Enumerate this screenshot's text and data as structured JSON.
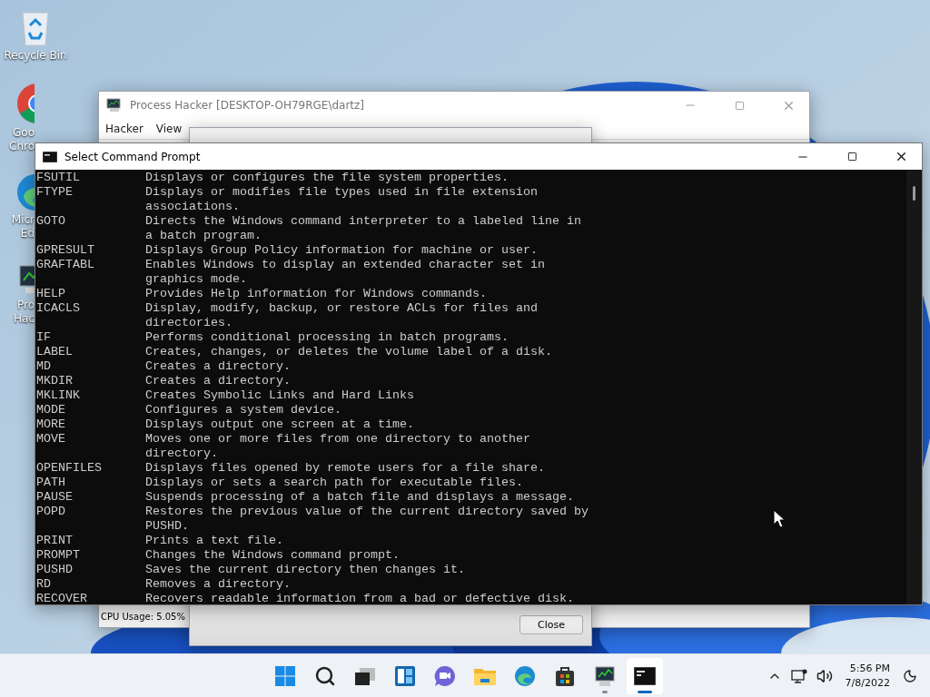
{
  "desktop_icons": [
    {
      "kind": "recycle-bin",
      "label_lines": [
        "Recycle Bin"
      ],
      "clipped": false
    },
    {
      "kind": "browser",
      "label_lines": [
        "Goo",
        "Chro"
      ],
      "clipped": true
    },
    {
      "kind": "edge",
      "label_lines": [
        "Micr",
        "Ed"
      ],
      "clipped": true
    },
    {
      "kind": "monitor-app",
      "label_lines": [
        "Pro",
        "Hac"
      ],
      "clipped": true
    }
  ],
  "process_hacker": {
    "title": "Process Hacker [DESKTOP-OH79RGE\\dartz]",
    "menu": [
      "Hacker",
      "View"
    ],
    "status": "CPU Usage: 5.05%"
  },
  "properties_dialog": {
    "button": "Close"
  },
  "command_prompt": {
    "title": "Select Command Prompt",
    "entries": [
      {
        "command": "FSUTIL",
        "description": [
          "Displays or configures the file system properties."
        ]
      },
      {
        "command": "FTYPE",
        "description": [
          "Displays or modifies file types used in file extension",
          "associations."
        ]
      },
      {
        "command": "GOTO",
        "description": [
          "Directs the Windows command interpreter to a labeled line in",
          "a batch program."
        ]
      },
      {
        "command": "GPRESULT",
        "description": [
          "Displays Group Policy information for machine or user."
        ]
      },
      {
        "command": "GRAFTABL",
        "description": [
          "Enables Windows to display an extended character set in",
          "graphics mode."
        ]
      },
      {
        "command": "HELP",
        "description": [
          "Provides Help information for Windows commands."
        ]
      },
      {
        "command": "ICACLS",
        "description": [
          "Display, modify, backup, or restore ACLs for files and",
          "directories."
        ]
      },
      {
        "command": "IF",
        "description": [
          "Performs conditional processing in batch programs."
        ]
      },
      {
        "command": "LABEL",
        "description": [
          "Creates, changes, or deletes the volume label of a disk."
        ]
      },
      {
        "command": "MD",
        "description": [
          "Creates a directory."
        ]
      },
      {
        "command": "MKDIR",
        "description": [
          "Creates a directory."
        ]
      },
      {
        "command": "MKLINK",
        "description": [
          "Creates Symbolic Links and Hard Links"
        ]
      },
      {
        "command": "MODE",
        "description": [
          "Configures a system device."
        ]
      },
      {
        "command": "MORE",
        "description": [
          "Displays output one screen at a time."
        ]
      },
      {
        "command": "MOVE",
        "description": [
          "Moves one or more files from one directory to another",
          "directory."
        ]
      },
      {
        "command": "OPENFILES",
        "description": [
          "Displays files opened by remote users for a file share."
        ]
      },
      {
        "command": "PATH",
        "description": [
          "Displays or sets a search path for executable files."
        ]
      },
      {
        "command": "PAUSE",
        "description": [
          "Suspends processing of a batch file and displays a message."
        ]
      },
      {
        "command": "POPD",
        "description": [
          "Restores the previous value of the current directory saved by",
          "PUSHD."
        ]
      },
      {
        "command": "PRINT",
        "description": [
          "Prints a text file."
        ]
      },
      {
        "command": "PROMPT",
        "description": [
          "Changes the Windows command prompt."
        ]
      },
      {
        "command": "PUSHD",
        "description": [
          "Saves the current directory then changes it."
        ]
      },
      {
        "command": "RD",
        "description": [
          "Removes a directory."
        ]
      },
      {
        "command": "RECOVER",
        "description": [
          "Recovers readable information from a bad or defective disk."
        ]
      }
    ]
  },
  "taskbar": {
    "apps": [
      {
        "kind": "start",
        "running": false,
        "selected": false
      },
      {
        "kind": "search",
        "running": false,
        "selected": false
      },
      {
        "kind": "task-view",
        "running": false,
        "selected": false
      },
      {
        "kind": "widgets",
        "running": false,
        "selected": false
      },
      {
        "kind": "chat",
        "running": false,
        "selected": false
      },
      {
        "kind": "explorer",
        "running": false,
        "selected": false
      },
      {
        "kind": "edge",
        "running": false,
        "selected": false
      },
      {
        "kind": "store",
        "running": false,
        "selected": false
      },
      {
        "kind": "monitor-app",
        "running": true,
        "selected": false
      },
      {
        "kind": "terminal",
        "running": true,
        "selected": true
      }
    ],
    "time": "5:56 PM",
    "date": "7/8/2022"
  }
}
